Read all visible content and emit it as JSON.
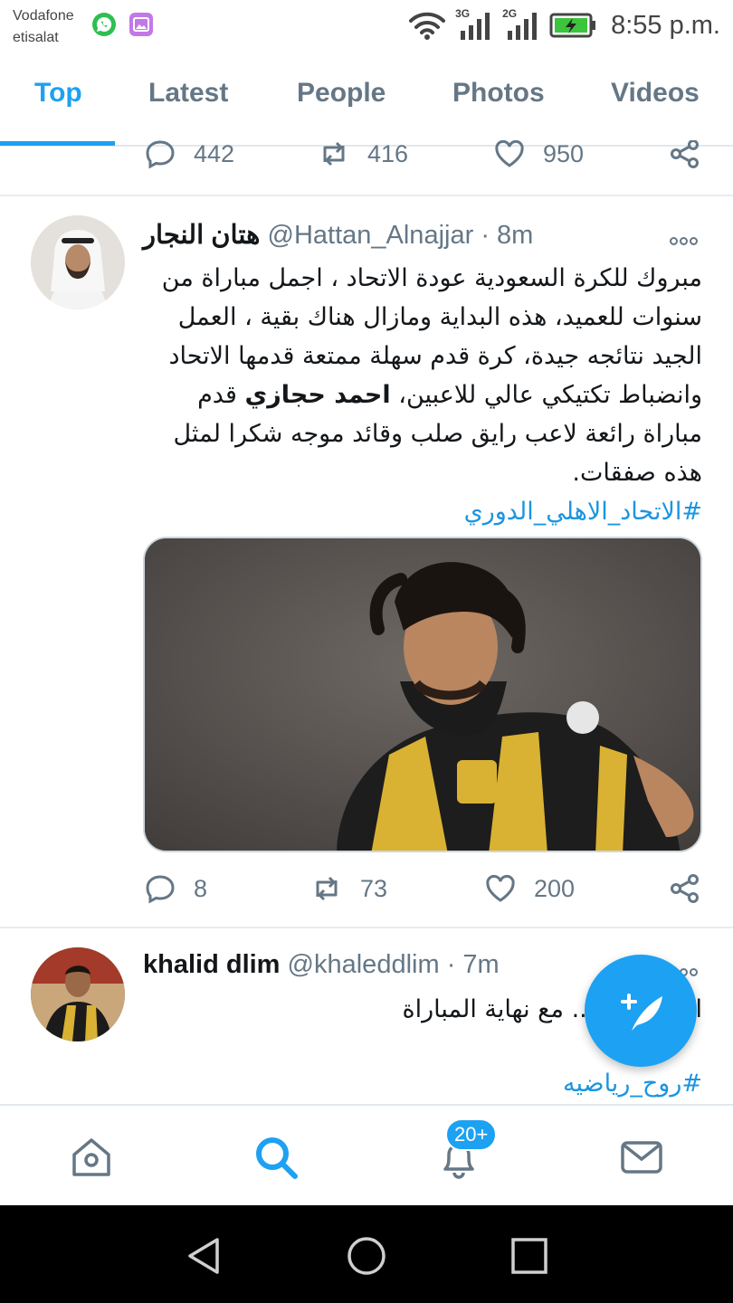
{
  "status_bar": {
    "carrier_line1": "Vodafone",
    "carrier_line2": "etisalat",
    "network_1": "3G",
    "network_2": "2G",
    "time": "8:55 p.m.",
    "icons": [
      "whatsapp-icon",
      "gallery-icon",
      "wifi-icon",
      "signal-icon",
      "battery-charging-icon"
    ]
  },
  "tabs": [
    {
      "label": "Top",
      "active": true
    },
    {
      "label": "Latest",
      "active": false
    },
    {
      "label": "People",
      "active": false
    },
    {
      "label": "Photos",
      "active": false
    },
    {
      "label": "Videos",
      "active": false
    }
  ],
  "prev_tweet_actions": {
    "replies": "442",
    "retweets": "416",
    "likes": "950"
  },
  "tweet1": {
    "name": "هتان النجار",
    "handle": "@Hattan_Alnajjar",
    "time": "8m",
    "body_before": "مبروك للكرة السعودية عودة الاتحاد ، اجمل مباراة من سنوات للعميد، هذه البداية ومازال هناك بقية ، العمل الجيد نتائجه جيدة، كرة قدم سهلة ممتعة قدمها الاتحاد وانضباط تكتيكي عالي للاعبين، ",
    "body_bold": "احمد حجازي",
    "body_after": " قدم مباراة رائعة لاعب رايق صلب وقائد موجه شكرا لمثل هذه صفقات.",
    "hashtag": "#الاتحاد_الاهلي_الدوري",
    "replies": "8",
    "retweets": "73",
    "likes": "200"
  },
  "tweet2": {
    "name": "khalid dlim",
    "handle": "@khaleddlim",
    "time": "7m",
    "body_visible": "ي .. مع نهاية المباراة",
    "body_lead": "ا",
    "hashtag": "#روح_رياضيه"
  },
  "bottom_nav": {
    "items": [
      "home-icon",
      "search-icon",
      "notifications-icon",
      "messages-icon"
    ],
    "notification_badge": "20+",
    "active": "search-icon"
  },
  "colors": {
    "accent": "#1da1f2",
    "muted": "#657786",
    "link": "#1b95e0"
  }
}
